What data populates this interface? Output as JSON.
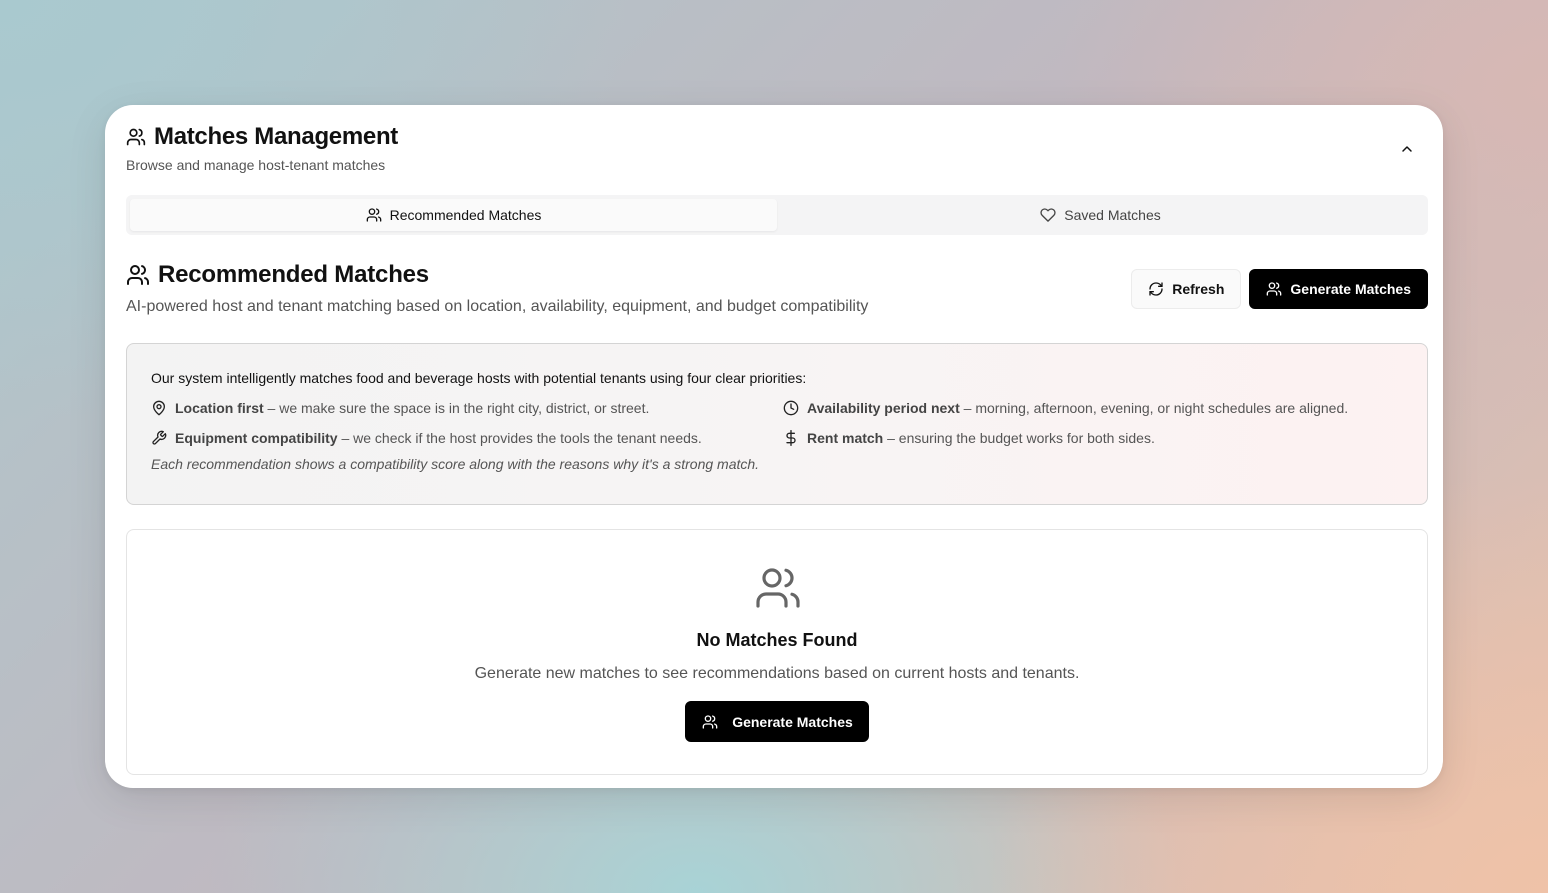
{
  "header": {
    "title": "Matches Management",
    "subtitle": "Browse and manage host-tenant matches",
    "title_icon": "users-icon",
    "collapse_icon": "chevron-up-icon"
  },
  "tabs": [
    {
      "label": "Recommended Matches",
      "icon": "users-icon",
      "active": true
    },
    {
      "label": "Saved Matches",
      "icon": "heart-icon",
      "active": false
    }
  ],
  "section": {
    "title": "Recommended Matches",
    "subtitle": "AI-powered host and tenant matching based on location, availability, equipment, and budget compatibility"
  },
  "actions": {
    "refresh_label": "Refresh",
    "generate_label": "Generate Matches"
  },
  "info": {
    "intro": "Our system intelligently matches food and beverage hosts with potential tenants using four clear priorities:",
    "items": [
      {
        "icon": "map-pin-icon",
        "bold": "Location first",
        "text": " – we make sure the space is in the right city, district, or street."
      },
      {
        "icon": "clock-icon",
        "bold": "Availability period next",
        "text": " – morning, afternoon, evening, or night schedules are aligned."
      },
      {
        "icon": "wrench-icon",
        "bold": "Equipment compatibility",
        "text": " – we check if the host provides the tools the tenant needs."
      },
      {
        "icon": "dollar-icon",
        "bold": "Rent match",
        "text": " – ensuring the budget works for both sides."
      }
    ],
    "note": "Each recommendation shows a compatibility score along with the reasons why it's a strong match."
  },
  "empty": {
    "title": "No Matches Found",
    "subtitle": "Generate new matches to see recommendations based on current hosts and tenants.",
    "button_label": "Generate Matches"
  },
  "colors": {
    "primary_button": "#000000",
    "muted_text": "#555555",
    "tab_bg": "#f4f4f5"
  }
}
